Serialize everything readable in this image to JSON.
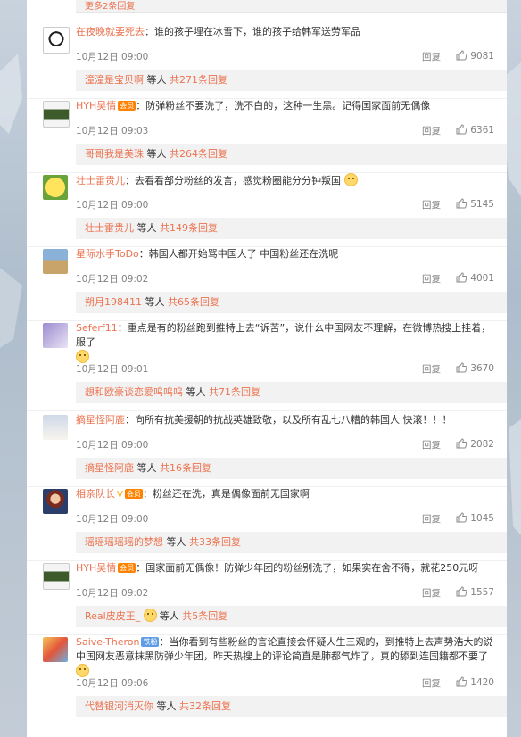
{
  "top": {
    "more_label": "更多2条回复"
  },
  "comments": [
    {
      "user": "在夜晚就要死去",
      "badges": [],
      "text": "谁的孩子埋在冰雪下，谁的孩子给韩军送劳军品",
      "time": "10月12日 09:00",
      "reply": "回复",
      "likes": "9081",
      "sub_user": "潼潼是宝贝啊",
      "sub_mid": "等人",
      "sub_count": "共271条回复"
    },
    {
      "user": "HYH吴情",
      "badges": [
        "vip"
      ],
      "text": "防弹粉丝不要洗了，洗不白的，这种一生黑。记得国家面前无偶像",
      "time": "10月12日 09:03",
      "reply": "回复",
      "likes": "6361",
      "sub_user": "哥哥我是美珠",
      "sub_mid": "等人",
      "sub_count": "共264条回复"
    },
    {
      "user": "壮士雷贵儿",
      "badges": [],
      "text": "去看看部分粉丝的发言，感觉粉圈能分分钟叛国",
      "time": "10月12日 09:00",
      "reply": "回复",
      "likes": "5145",
      "sub_user": "壮士雷贵儿",
      "sub_mid": "等人",
      "sub_count": "共149条回复"
    },
    {
      "user": "星际水手ToDo",
      "badges": [],
      "text": "韩国人都开始骂中国人了 中国粉丝还在洗呢",
      "time": "10月12日 09:02",
      "reply": "回复",
      "likes": "4001",
      "sub_user": "朔月198411",
      "sub_mid": "等人",
      "sub_count": "共65条回复"
    },
    {
      "user": "Seferf11",
      "badges": [],
      "text": "重点是有的粉丝跑到推特上去“诉苦”，说什么中国网友不理解，在微博热搜上挂着，服了",
      "time": "10月12日 09:01",
      "reply": "回复",
      "likes": "3670",
      "sub_user": "想和欧豪谈恋爱呜呜呜",
      "sub_mid": "等人",
      "sub_count": "共71条回复"
    },
    {
      "user": "摘星怪阿鹿",
      "badges": [],
      "text": "向所有抗美援朝的抗战英雄致敬，以及所有乱七八糟的韩国人 快滚！！！",
      "time": "10月12日 09:00",
      "reply": "回复",
      "likes": "2082",
      "sub_user": "摘星怪阿鹿",
      "sub_mid": "等人",
      "sub_count": "共16条回复"
    },
    {
      "user": "相亲队长",
      "badges": [
        "v",
        "vip"
      ],
      "text": "粉丝还在洗，真是偶像面前无国家啊",
      "time": "10月12日 09:00",
      "reply": "回复",
      "likes": "1045",
      "sub_user": "瑶瑶瑶瑶瑶的梦想",
      "sub_mid": "等人",
      "sub_count": "共33条回复"
    },
    {
      "user": "HYH吴情",
      "badges": [
        "vip"
      ],
      "text": "国家面前无偶像！防弹少年团的粉丝别洗了，如果实在舍不得，就花250元呀",
      "time": "10月12日 09:02",
      "reply": "回复",
      "likes": "1557",
      "sub_user": "Real皮皮王_",
      "sub_mid": "等人",
      "sub_count": "共5条回复"
    },
    {
      "user": "Saive-Theron",
      "badges": [
        "fan"
      ],
      "text": "当你看到有些粉丝的言论直接会怀疑人生三观的，到推特上去声势浩大的说中国网友恶意抹黑防弹少年团，昨天热搜上的评论简直是肺都气炸了，真的舔到连国籍都不要了",
      "time": "10月12日 09:06",
      "reply": "回复",
      "likes": "1420",
      "sub_user": "代替银河消灭你",
      "sub_mid": "等人",
      "sub_count": "共32条回复"
    }
  ],
  "badges": {
    "vip_label": "会员",
    "fan_label": "铁粉",
    "v_label": "V"
  },
  "colors": {
    "accent": "#eb7350",
    "meta": "#808080",
    "sub_bg": "#f2f2f2"
  }
}
